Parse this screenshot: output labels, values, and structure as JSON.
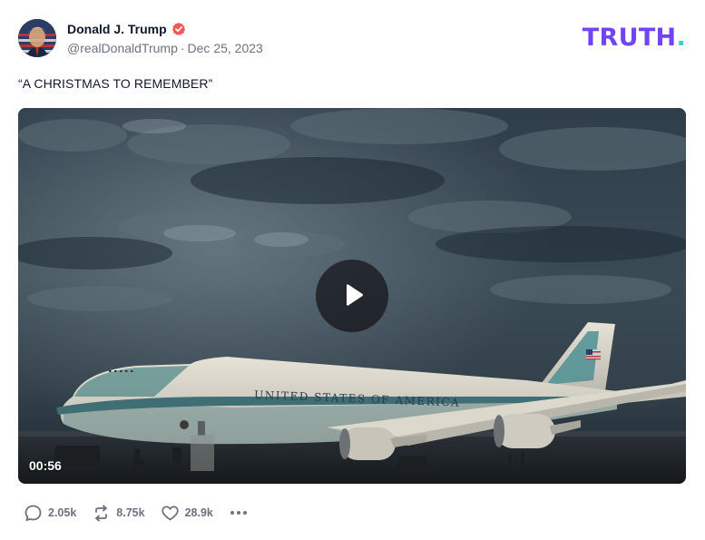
{
  "author": {
    "display_name": "Donald J. Trump",
    "handle": "@realDonaldTrump",
    "date": "Dec 25, 2023",
    "separator": "·",
    "verified_icon": "verified-badge-icon",
    "verified_color": "#f05a5a"
  },
  "brand": {
    "text": "TRUTH",
    "dot": ".",
    "color": "#7145f5",
    "dot_color": "#3ed0c0"
  },
  "post": {
    "text": "“A CHRISTMAS TO REMEMBER”"
  },
  "media": {
    "type": "video",
    "duration": "00:56",
    "play_icon": "play-icon",
    "airplane_text": "UNITED STATES OF AMERICA"
  },
  "actions": {
    "replies": {
      "icon": "reply-icon",
      "count": "2.05k"
    },
    "retruths": {
      "icon": "retruth-icon",
      "count": "8.75k"
    },
    "likes": {
      "icon": "heart-icon",
      "count": "28.9k"
    },
    "more_icon": "more-dots-icon"
  }
}
